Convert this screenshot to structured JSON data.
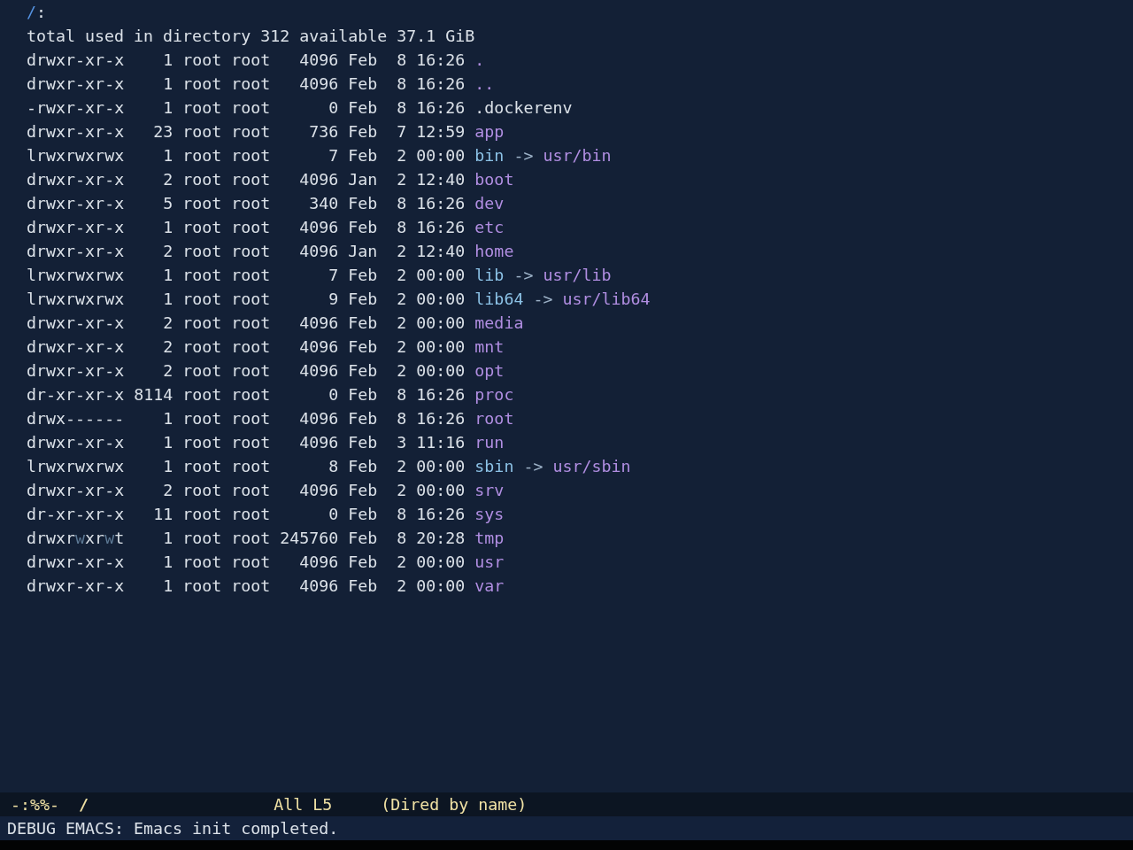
{
  "dired": {
    "header": {
      "path": "/",
      "colon": ":"
    },
    "summary": "total used in directory 312 available 37.1 GiB",
    "entries": [
      {
        "permissions": "drwxr-xr-x",
        "write_marked": false,
        "links": "1",
        "owner": "root",
        "group": "root",
        "size": "4096",
        "month": "Feb",
        "day": "8",
        "time": "16:26",
        "name": ".",
        "kind": "dir"
      },
      {
        "permissions": "drwxr-xr-x",
        "write_marked": false,
        "links": "1",
        "owner": "root",
        "group": "root",
        "size": "4096",
        "month": "Feb",
        "day": "8",
        "time": "16:26",
        "name": "..",
        "kind": "dir"
      },
      {
        "permissions": "-rwxr-xr-x",
        "write_marked": false,
        "links": "1",
        "owner": "root",
        "group": "root",
        "size": "0",
        "month": "Feb",
        "day": "8",
        "time": "16:26",
        "name": ".dockerenv",
        "kind": "file"
      },
      {
        "permissions": "drwxr-xr-x",
        "write_marked": false,
        "links": "23",
        "owner": "root",
        "group": "root",
        "size": "736",
        "month": "Feb",
        "day": "7",
        "time": "12:59",
        "name": "app",
        "kind": "dir"
      },
      {
        "permissions": "lrwxrwxrwx",
        "write_marked": false,
        "links": "1",
        "owner": "root",
        "group": "root",
        "size": "7",
        "month": "Feb",
        "day": "2",
        "time": "00:00",
        "name": "bin",
        "kind": "symlink",
        "arrow": "->",
        "target": "usr/bin"
      },
      {
        "permissions": "drwxr-xr-x",
        "write_marked": false,
        "links": "2",
        "owner": "root",
        "group": "root",
        "size": "4096",
        "month": "Jan",
        "day": "2",
        "time": "12:40",
        "name": "boot",
        "kind": "dir"
      },
      {
        "permissions": "drwxr-xr-x",
        "write_marked": false,
        "links": "5",
        "owner": "root",
        "group": "root",
        "size": "340",
        "month": "Feb",
        "day": "8",
        "time": "16:26",
        "name": "dev",
        "kind": "dir"
      },
      {
        "permissions": "drwxr-xr-x",
        "write_marked": false,
        "links": "1",
        "owner": "root",
        "group": "root",
        "size": "4096",
        "month": "Feb",
        "day": "8",
        "time": "16:26",
        "name": "etc",
        "kind": "dir"
      },
      {
        "permissions": "drwxr-xr-x",
        "write_marked": false,
        "links": "2",
        "owner": "root",
        "group": "root",
        "size": "4096",
        "month": "Jan",
        "day": "2",
        "time": "12:40",
        "name": "home",
        "kind": "dir"
      },
      {
        "permissions": "lrwxrwxrwx",
        "write_marked": false,
        "links": "1",
        "owner": "root",
        "group": "root",
        "size": "7",
        "month": "Feb",
        "day": "2",
        "time": "00:00",
        "name": "lib",
        "kind": "symlink",
        "arrow": "->",
        "target": "usr/lib"
      },
      {
        "permissions": "lrwxrwxrwx",
        "write_marked": false,
        "links": "1",
        "owner": "root",
        "group": "root",
        "size": "9",
        "month": "Feb",
        "day": "2",
        "time": "00:00",
        "name": "lib64",
        "kind": "symlink",
        "arrow": "->",
        "target": "usr/lib64"
      },
      {
        "permissions": "drwxr-xr-x",
        "write_marked": false,
        "links": "2",
        "owner": "root",
        "group": "root",
        "size": "4096",
        "month": "Feb",
        "day": "2",
        "time": "00:00",
        "name": "media",
        "kind": "dir"
      },
      {
        "permissions": "drwxr-xr-x",
        "write_marked": false,
        "links": "2",
        "owner": "root",
        "group": "root",
        "size": "4096",
        "month": "Feb",
        "day": "2",
        "time": "00:00",
        "name": "mnt",
        "kind": "dir"
      },
      {
        "permissions": "drwxr-xr-x",
        "write_marked": false,
        "links": "2",
        "owner": "root",
        "group": "root",
        "size": "4096",
        "month": "Feb",
        "day": "2",
        "time": "00:00",
        "name": "opt",
        "kind": "dir"
      },
      {
        "permissions": "dr-xr-xr-x",
        "write_marked": false,
        "links": "8114",
        "owner": "root",
        "group": "root",
        "size": "0",
        "month": "Feb",
        "day": "8",
        "time": "16:26",
        "name": "proc",
        "kind": "dir"
      },
      {
        "permissions": "drwx------",
        "write_marked": false,
        "links": "1",
        "owner": "root",
        "group": "root",
        "size": "4096",
        "month": "Feb",
        "day": "8",
        "time": "16:26",
        "name": "root",
        "kind": "dir"
      },
      {
        "permissions": "drwxr-xr-x",
        "write_marked": false,
        "links": "1",
        "owner": "root",
        "group": "root",
        "size": "4096",
        "month": "Feb",
        "day": "3",
        "time": "11:16",
        "name": "run",
        "kind": "dir"
      },
      {
        "permissions": "lrwxrwxrwx",
        "write_marked": false,
        "links": "1",
        "owner": "root",
        "group": "root",
        "size": "8",
        "month": "Feb",
        "day": "2",
        "time": "00:00",
        "name": "sbin",
        "kind": "symlink",
        "arrow": "->",
        "target": "usr/sbin"
      },
      {
        "permissions": "drwxr-xr-x",
        "write_marked": false,
        "links": "2",
        "owner": "root",
        "group": "root",
        "size": "4096",
        "month": "Feb",
        "day": "2",
        "time": "00:00",
        "name": "srv",
        "kind": "dir"
      },
      {
        "permissions": "dr-xr-xr-x",
        "write_marked": false,
        "links": "11",
        "owner": "root",
        "group": "root",
        "size": "0",
        "month": "Feb",
        "day": "8",
        "time": "16:26",
        "name": "sys",
        "kind": "dir"
      },
      {
        "permissions": "drwxrwxrwt",
        "write_marked": true,
        "links": "1",
        "owner": "root",
        "group": "root",
        "size": "245760",
        "month": "Feb",
        "day": "8",
        "time": "20:28",
        "name": "tmp",
        "kind": "dir"
      },
      {
        "permissions": "drwxr-xr-x",
        "write_marked": false,
        "links": "1",
        "owner": "root",
        "group": "root",
        "size": "4096",
        "month": "Feb",
        "day": "2",
        "time": "00:00",
        "name": "usr",
        "kind": "dir"
      },
      {
        "permissions": "drwxr-xr-x",
        "write_marked": false,
        "links": "1",
        "owner": "root",
        "group": "root",
        "size": "4096",
        "month": "Feb",
        "day": "2",
        "time": "00:00",
        "name": "var",
        "kind": "dir"
      }
    ]
  },
  "mode_line": {
    "status": "-:%%-",
    "buffer_name": "/",
    "position": "All",
    "line": "L5",
    "mode": "(Dired by name)"
  },
  "echo_area": {
    "message": "DEBUG EMACS: Emacs init completed."
  }
}
